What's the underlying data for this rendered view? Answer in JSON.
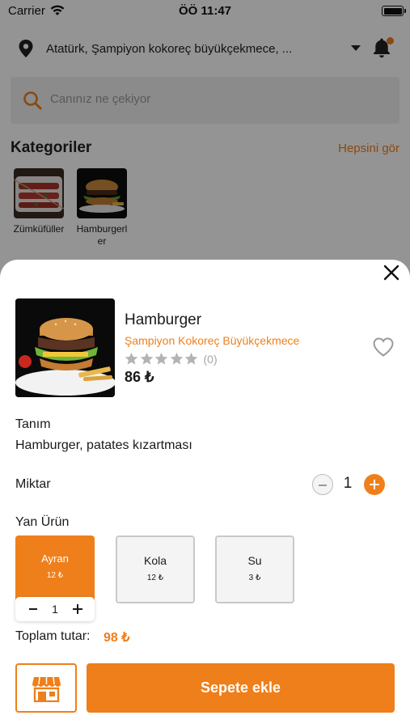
{
  "status_bar": {
    "carrier": "Carrier",
    "time": "ÖÖ 11:47"
  },
  "header": {
    "location": "Atatürk, Şampiyon kokoreç büyükçekmece, ...",
    "location_icon": "map-pin-icon",
    "notification_icon": "bell-icon"
  },
  "search": {
    "placeholder": "Canınız ne çekiyor"
  },
  "categories": {
    "title": "Kategoriler",
    "see_all": "Hepsini gör",
    "items": [
      {
        "label": "Zümküfüller"
      },
      {
        "label": "Hamburgerler"
      }
    ]
  },
  "product": {
    "name": "Hamburger",
    "store": "Şampiyon Kokoreç Büyükçekmece",
    "rating": 0,
    "rating_count": "(0)",
    "price": "86 ₺"
  },
  "description": {
    "title": "Tanım",
    "text": "Hamburger, patates kızartması"
  },
  "quantity": {
    "label": "Miktar",
    "value": "1"
  },
  "side_products": {
    "title": "Yan Ürün",
    "items": [
      {
        "name": "Ayran",
        "price": "12 ₺",
        "selected": true,
        "qty": "1"
      },
      {
        "name": "Kola",
        "price": "12 ₺",
        "selected": false
      },
      {
        "name": "Su",
        "price": "3 ₺",
        "selected": false
      }
    ]
  },
  "total": {
    "label": "Toplam tutar:",
    "value": "98 ₺"
  },
  "actions": {
    "add_to_cart": "Sepete ekle",
    "store_icon": "store-icon"
  },
  "colors": {
    "accent": "#ef7f1a",
    "star_empty": "#b3b3b3"
  }
}
